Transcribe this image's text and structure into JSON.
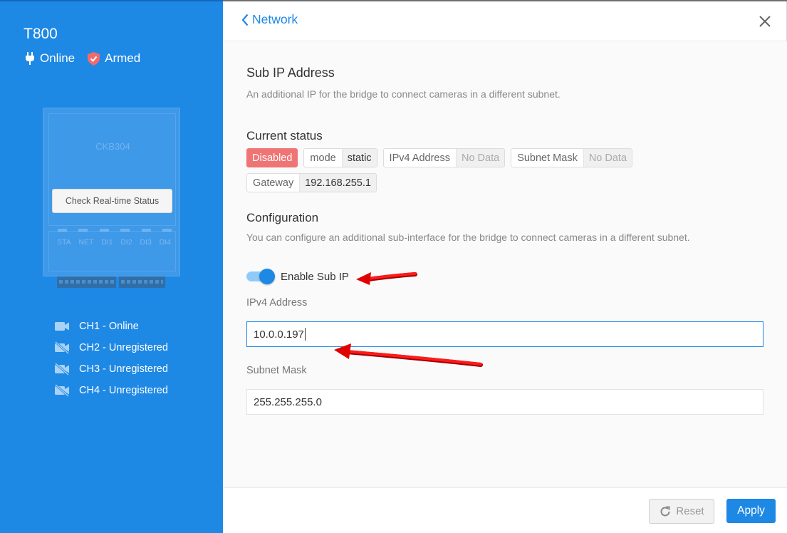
{
  "sidebar": {
    "device_name": "T800",
    "online_label": "Online",
    "armed_label": "Armed",
    "device_model": "CKB304",
    "check_button": "Check Real-time Status",
    "port_labels": [
      "STA",
      "NET",
      "DI1",
      "DI2",
      "DI3",
      "DI4"
    ],
    "channels": [
      {
        "label": "CH1 - Online",
        "icon": "camera-icon"
      },
      {
        "label": "CH2 - Unregistered",
        "icon": "camera-off-icon"
      },
      {
        "label": "CH3 - Unregistered",
        "icon": "camera-off-icon"
      },
      {
        "label": "CH4 - Unregistered",
        "icon": "camera-off-icon"
      }
    ]
  },
  "header": {
    "back_label": "Network"
  },
  "sub_ip": {
    "title": "Sub IP Address",
    "description": "An additional IP for the bridge to connect cameras in a different subnet."
  },
  "current_status": {
    "title": "Current status",
    "state": "Disabled",
    "mode_key": "mode",
    "mode_value": "static",
    "ipv4_key": "IPv4 Address",
    "ipv4_value": "No Data",
    "mask_key": "Subnet Mask",
    "mask_value": "No Data",
    "gateway_key": "Gateway",
    "gateway_value": "192.168.255.1"
  },
  "configuration": {
    "title": "Configuration",
    "description": "You can configure an additional sub-interface for the bridge to connect cameras in a different subnet.",
    "enable_label": "Enable Sub IP",
    "enabled": true,
    "ipv4_label": "IPv4 Address",
    "ipv4_value": "10.0.0.197",
    "mask_label": "Subnet Mask",
    "mask_value": "255.255.255.0"
  },
  "footer": {
    "reset_label": "Reset",
    "apply_label": "Apply"
  },
  "colors": {
    "sidebar_bg": "#1e88e5",
    "accent": "#1e88e5",
    "disabled_badge": "#ef7474",
    "annotation_arrow": "#e00000"
  }
}
